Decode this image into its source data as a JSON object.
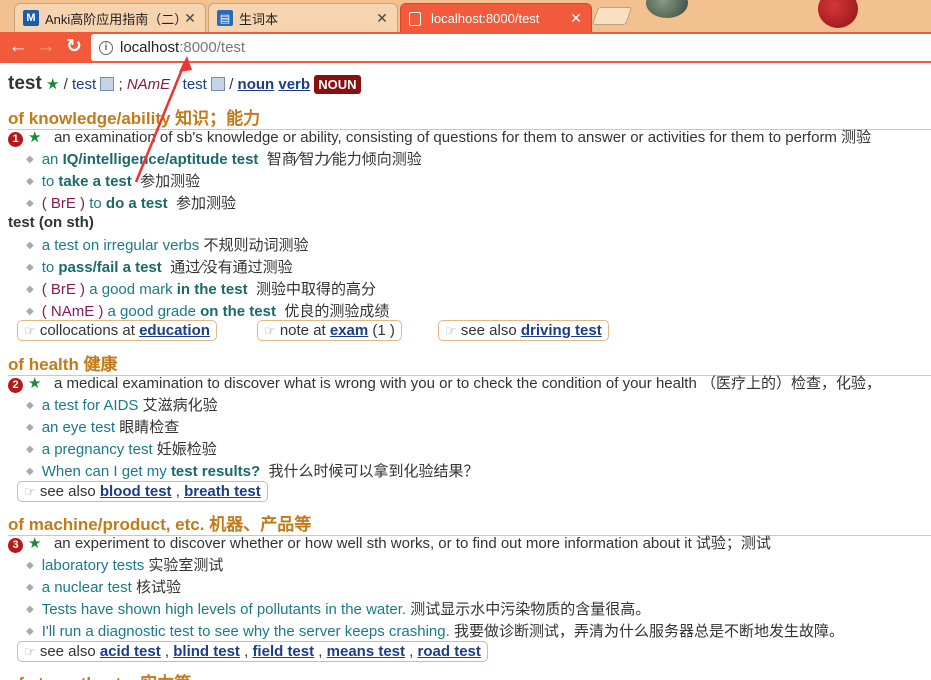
{
  "tabs": [
    {
      "title": "Anki高阶应用指南（二）",
      "favicon": "M"
    },
    {
      "title": "生词本",
      "favicon": "▤"
    },
    {
      "title": "localhost:8000/test",
      "favicon": "▭"
    }
  ],
  "address": {
    "host": "localhost",
    "path": ":8000/test"
  },
  "entry": {
    "headword": "test",
    "ipa_br": "test",
    "ipa_name": "NAmE",
    "ipa_am": "test",
    "pos_links": [
      "noun",
      "verb"
    ],
    "pos_badge": "NOUN"
  },
  "senses": [
    {
      "head": "of knowledge/ability 知识；能力",
      "num": "1",
      "definition": "an examination of sb's knowledge or ability, consisting of questions for them to answer or activities for them to perform 测验",
      "examples": [
        {
          "pre": "an ",
          "bold": "IQ/intelligence/aptitude test",
          "post": "",
          "zh": "智商∕智力∕能力倾向测验"
        },
        {
          "pre": "to ",
          "bold": "take a test",
          "post": "",
          "zh": "参加测验"
        },
        {
          "reg": "( BrE )",
          "pre": " to ",
          "bold": "do a test",
          "post": "",
          "zh": "参加测验"
        }
      ],
      "idiom": "test (on sth)",
      "idiom_examples": [
        {
          "pre": "a test on irregular verbs",
          "bold": "",
          "post": "",
          "zh": "不规则动词测验"
        },
        {
          "pre": "to ",
          "bold": "pass/fail a test",
          "post": "",
          "zh": "通过∕没有通过测验"
        },
        {
          "reg": "( BrE )",
          "pre": " a good mark ",
          "bold": "in the test",
          "post": "",
          "zh": "测验中取得的高分"
        },
        {
          "reg": "( NAmE )",
          "pre": " a good grade ",
          "bold": "on the test",
          "post": "",
          "zh": "优良的测验成绩"
        }
      ],
      "xrefs": [
        {
          "label": "collocations at ",
          "links": [
            "education"
          ],
          "suffix": ""
        },
        {
          "label": "note at ",
          "links": [
            "exam"
          ],
          "suffix": " (1 )"
        },
        {
          "label": "see also ",
          "links": [
            "driving test"
          ],
          "suffix": ""
        }
      ]
    },
    {
      "head": "of health 健康",
      "num": "2",
      "definition": "a medical examination to discover what is wrong with you or to check the condition of your health （医疗上的）检查，化验，",
      "examples": [
        {
          "pre": "a test for AIDS",
          "zh": "艾滋病化验"
        },
        {
          "pre": "an eye test",
          "zh": "眼睛检查"
        },
        {
          "pre": "a pregnancy test",
          "zh": "妊娠检验"
        },
        {
          "pre": "When can I get my ",
          "bold": "test results?",
          "zh": "我什么时候可以拿到化验结果？"
        }
      ],
      "xrefs": [
        {
          "label": "see also ",
          "links": [
            "blood test",
            "breath test"
          ],
          "suffix": ""
        }
      ]
    },
    {
      "head": "of machine/product, etc. 机器、产品等",
      "num": "3",
      "definition": "an experiment to discover whether or how well sth works, or to find out more information about it 试验；测试",
      "examples": [
        {
          "pre": "laboratory tests",
          "zh": "实验室测试"
        },
        {
          "pre": "a nuclear test",
          "zh": "核试验"
        },
        {
          "pre": "Tests have shown high levels of pollutants in the water.",
          "zh": "测试显示水中污染物质的含量很高。"
        },
        {
          "pre": "I'll run a diagnostic test to see why the server keeps crashing.",
          "zh": "我要做诊断测试，弄清为什么服务器总是不断地发生故障。"
        }
      ],
      "xrefs": [
        {
          "label": "see also ",
          "links": [
            "acid test",
            "blind test",
            "field test",
            "means test",
            "road test"
          ],
          "suffix": ""
        }
      ]
    },
    {
      "head": "of strength, etc. 实力等"
    }
  ]
}
